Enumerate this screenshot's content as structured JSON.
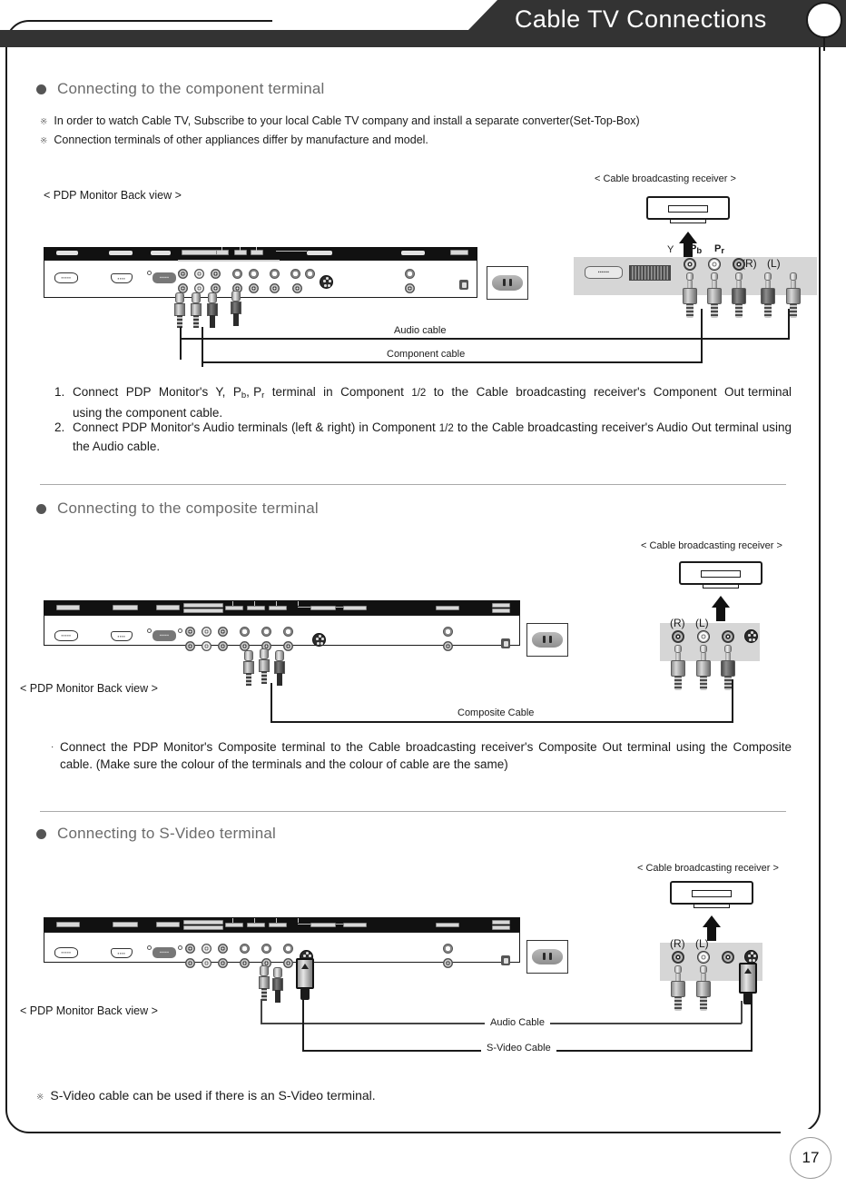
{
  "header": {
    "title": "Cable TV Connections",
    "circle_icon": "circle-badge-icon"
  },
  "page_number": "17",
  "sections": [
    {
      "id": "component",
      "heading": "Connecting to the component terminal",
      "notes": [
        "In order to watch Cable TV, Subscribe to your local Cable TV company and install a separate converter(Set-Top-Box)",
        "Connection terminals of other appliances differ by manufacture and model."
      ],
      "monitor_caption": "< PDP Monitor Back view >",
      "receiver_caption": "< Cable broadcasting receiver >",
      "terminal_labels": [
        "Y",
        "Pb",
        "Pr",
        "(R)",
        "(L)"
      ],
      "cable_labels": [
        "Audio cable",
        "Component cable"
      ],
      "steps": [
        {
          "num": "1.",
          "text_parts": [
            "Connect PDP Monitor's Y, P",
            "b",
            ", P",
            "r",
            " terminal in Component ",
            "1/2",
            " to the Cable broadcasting receiver's Component Out terminal using the component cable."
          ],
          "plain": "Connect PDP Monitor's Y, Pb, Pr terminal in Component 1/2 to the Cable broadcasting receiver's Component Out terminal using the component cable."
        },
        {
          "num": "2.",
          "plain": "Connect PDP Monitor's Audio terminals (left & right) in Component 1/2 to the Cable broadcasting receiver's Audio Out terminal using the Audio cable."
        }
      ]
    },
    {
      "id": "composite",
      "heading": "Connecting to the composite terminal",
      "monitor_caption": "< PDP Monitor Back view >",
      "receiver_caption": "< Cable broadcasting receiver >",
      "terminal_labels": [
        "(R)",
        "(L)"
      ],
      "cable_labels": [
        "Composite Cable"
      ],
      "body": "Connect the PDP Monitor's Composite terminal to the Cable broadcasting receiver's Composite Out terminal using the Composite cable. (Make sure the colour of the terminals and the colour of cable are the same)"
    },
    {
      "id": "svideo",
      "heading": "Connecting to S-Video terminal",
      "monitor_caption": "< PDP Monitor Back view >",
      "receiver_caption": "< Cable broadcasting receiver >",
      "terminal_labels": [
        "(R)",
        "(L)"
      ],
      "cable_labels": [
        "Audio Cable",
        "S-Video Cable"
      ],
      "footnote": "S-Video cable can be used if there is an S-Video terminal."
    }
  ],
  "marks": {
    "reference_mark": "※",
    "bullet_dot": "●"
  },
  "colors": {
    "banner": "#333333",
    "heading_text": "#6b6b6b",
    "panel_strip": "#111111",
    "plate_grey": "#d6d6d6",
    "divider": "#aaaaaa"
  }
}
